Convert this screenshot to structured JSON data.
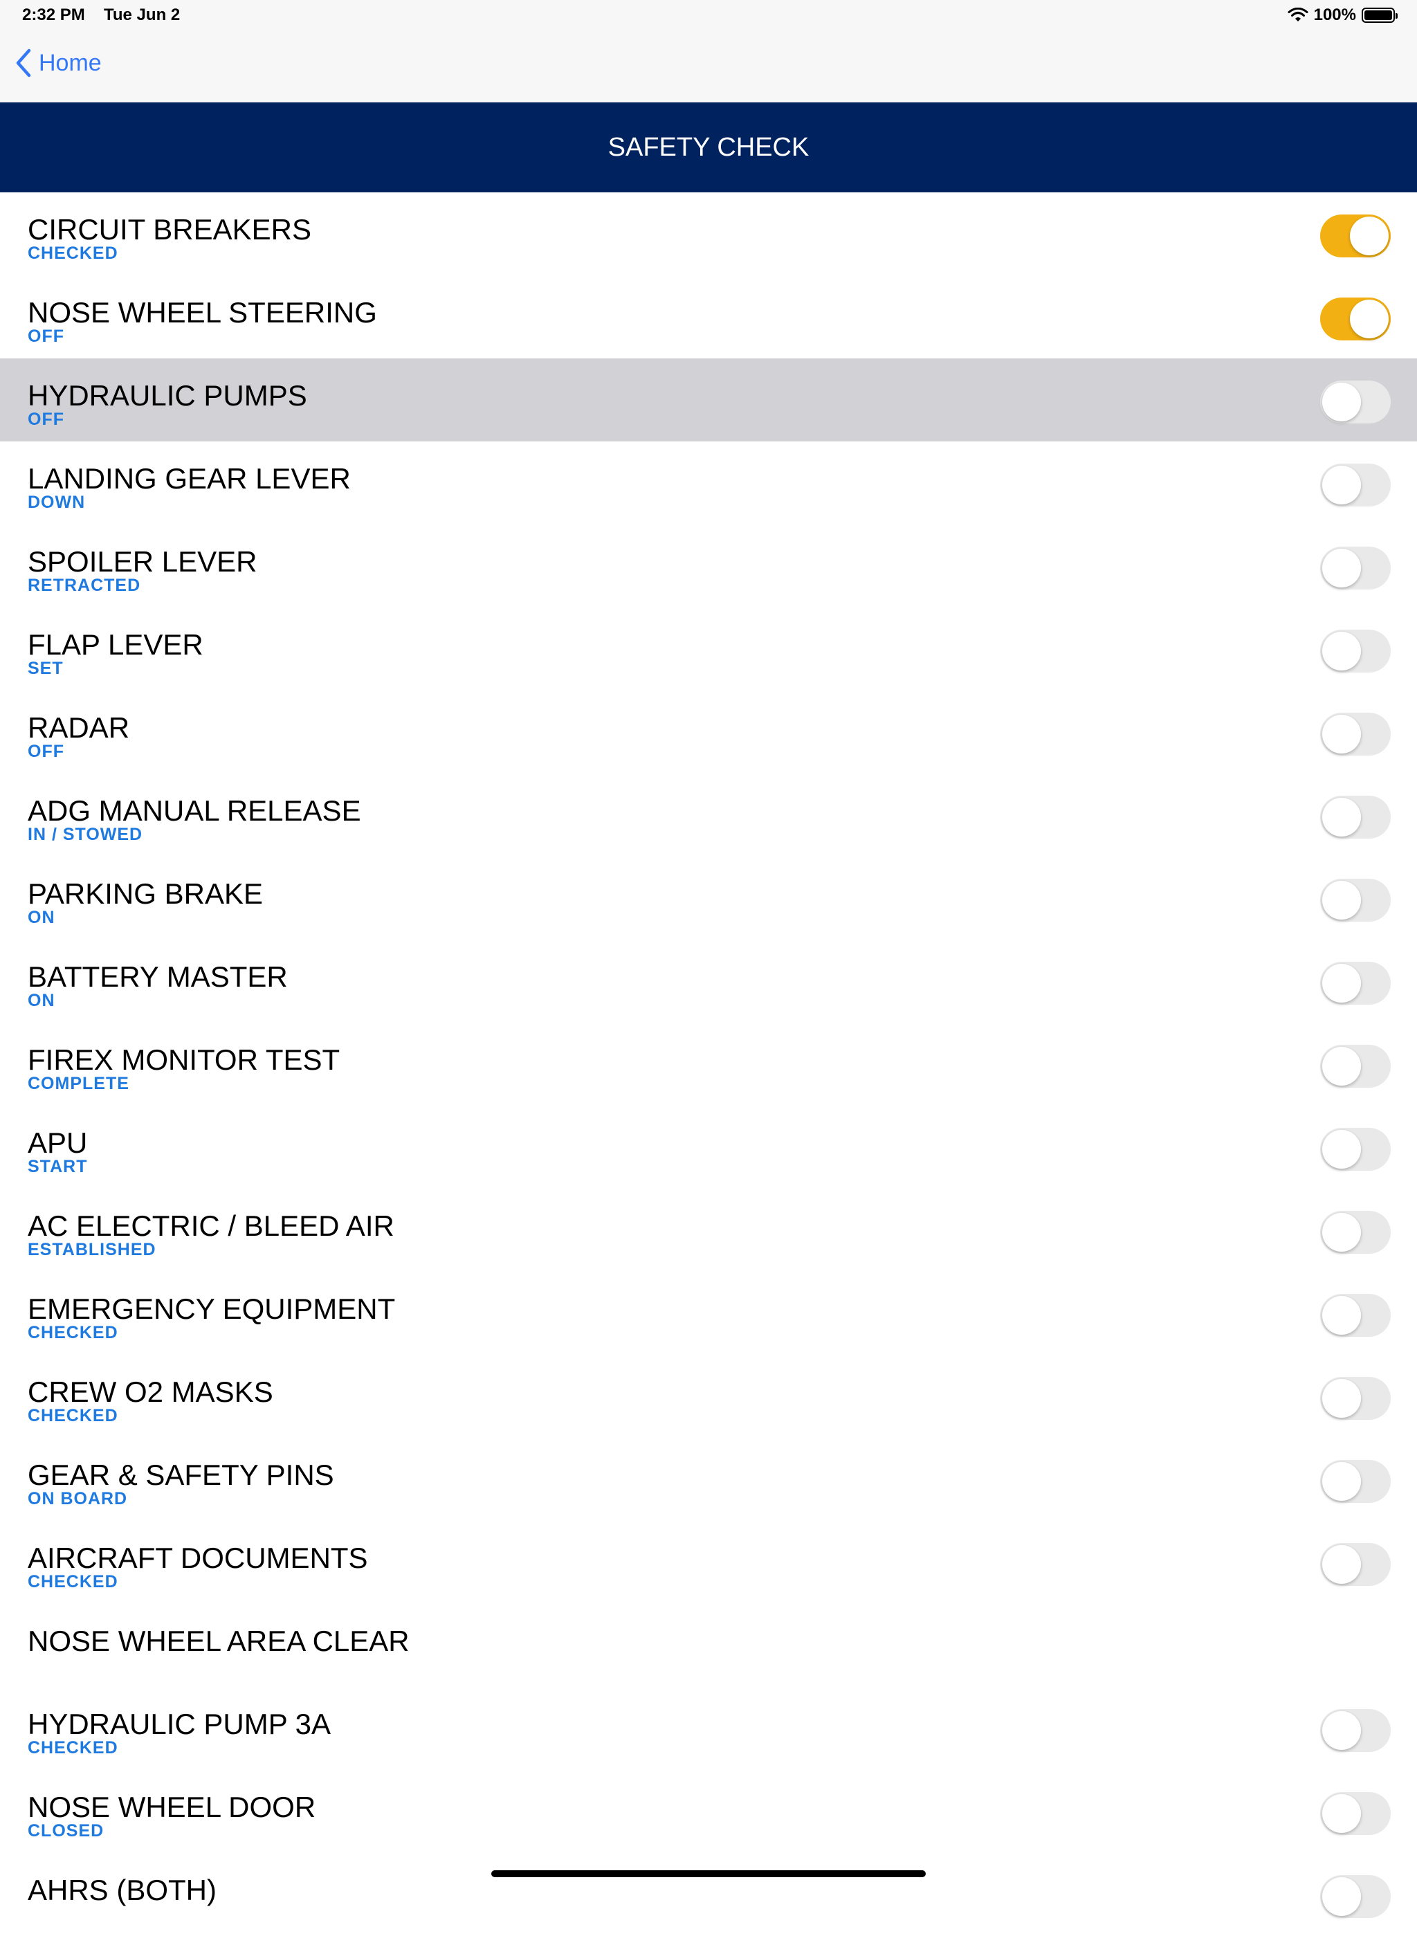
{
  "status_bar": {
    "time": "2:32 PM",
    "date": "Tue Jun 2",
    "battery": "100%"
  },
  "nav": {
    "back_label": "Home"
  },
  "header": {
    "title": "SAFETY CHECK"
  },
  "checklist": [
    {
      "label": "CIRCUIT BREAKERS",
      "state": "CHECKED",
      "toggle": true,
      "on": true,
      "selected": false
    },
    {
      "label": "NOSE WHEEL STEERING",
      "state": "OFF",
      "toggle": true,
      "on": true,
      "selected": false
    },
    {
      "label": "HYDRAULIC PUMPS",
      "state": "OFF",
      "toggle": true,
      "on": false,
      "selected": true
    },
    {
      "label": "LANDING GEAR LEVER",
      "state": "DOWN",
      "toggle": true,
      "on": false,
      "selected": false
    },
    {
      "label": "SPOILER LEVER",
      "state": "RETRACTED",
      "toggle": true,
      "on": false,
      "selected": false
    },
    {
      "label": "FLAP LEVER",
      "state": "SET",
      "toggle": true,
      "on": false,
      "selected": false
    },
    {
      "label": "RADAR",
      "state": "OFF",
      "toggle": true,
      "on": false,
      "selected": false
    },
    {
      "label": "ADG MANUAL RELEASE",
      "state": "IN / STOWED",
      "toggle": true,
      "on": false,
      "selected": false
    },
    {
      "label": "PARKING BRAKE",
      "state": "ON",
      "toggle": true,
      "on": false,
      "selected": false
    },
    {
      "label": "BATTERY MASTER",
      "state": "ON",
      "toggle": true,
      "on": false,
      "selected": false
    },
    {
      "label": "FIREX MONITOR TEST",
      "state": "COMPLETE",
      "toggle": true,
      "on": false,
      "selected": false
    },
    {
      "label": "APU",
      "state": "START",
      "toggle": true,
      "on": false,
      "selected": false
    },
    {
      "label": "AC ELECTRIC / BLEED AIR",
      "state": "ESTABLISHED",
      "toggle": true,
      "on": false,
      "selected": false
    },
    {
      "label": "EMERGENCY EQUIPMENT",
      "state": "CHECKED",
      "toggle": true,
      "on": false,
      "selected": false
    },
    {
      "label": "CREW O2 MASKS",
      "state": "CHECKED",
      "toggle": true,
      "on": false,
      "selected": false
    },
    {
      "label": "GEAR & SAFETY PINS",
      "state": "ON BOARD",
      "toggle": true,
      "on": false,
      "selected": false
    },
    {
      "label": "AIRCRAFT DOCUMENTS",
      "state": "CHECKED",
      "toggle": true,
      "on": false,
      "selected": false
    },
    {
      "label": "NOSE WHEEL AREA CLEAR",
      "state": "",
      "toggle": false,
      "on": false,
      "selected": false
    },
    {
      "label": "HYDRAULIC PUMP 3A",
      "state": "CHECKED",
      "toggle": true,
      "on": false,
      "selected": false
    },
    {
      "label": "NOSE WHEEL DOOR",
      "state": "CLOSED",
      "toggle": true,
      "on": false,
      "selected": false
    },
    {
      "label": "AHRS (BOTH)",
      "state": "",
      "toggle": true,
      "on": false,
      "selected": false
    }
  ],
  "colors": {
    "header_bg": "#00235f",
    "accent_blue": "#1f7ae0",
    "toggle_on": "#f3b012",
    "toggle_off": "#e9e9ea",
    "selected_row": "#d1d1d6"
  }
}
